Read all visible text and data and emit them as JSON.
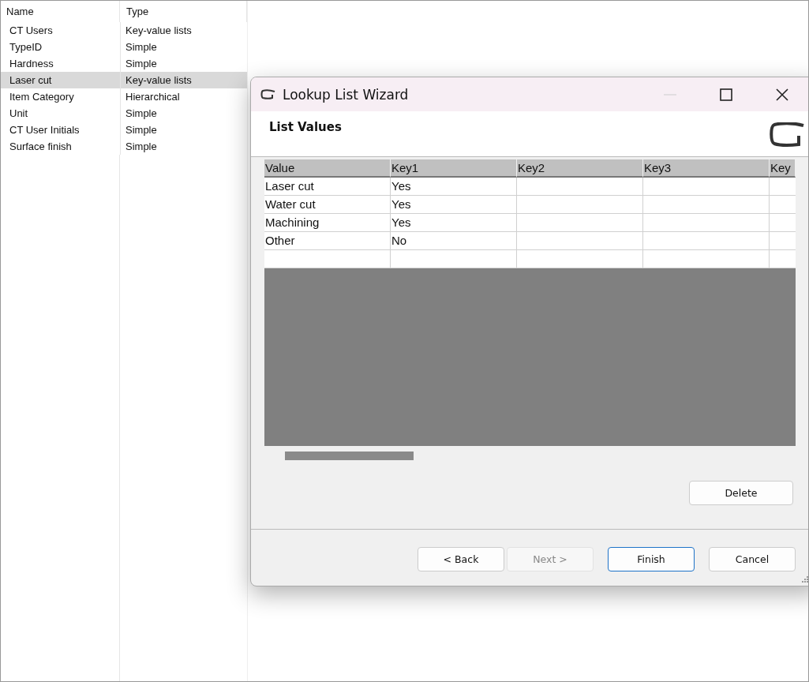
{
  "list": {
    "columns": [
      "Name",
      "Type"
    ],
    "rows": [
      {
        "name": "CT Users",
        "type": "Key-value lists",
        "selected": false
      },
      {
        "name": "TypeID",
        "type": "Simple",
        "selected": false
      },
      {
        "name": "Hardness",
        "type": "Simple",
        "selected": false
      },
      {
        "name": "Laser cut",
        "type": "Key-value lists",
        "selected": true
      },
      {
        "name": "Item Category",
        "type": "Hierarchical",
        "selected": false
      },
      {
        "name": "Unit",
        "type": "Simple",
        "selected": false
      },
      {
        "name": "CT User Initials",
        "type": "Simple",
        "selected": false
      },
      {
        "name": "Surface finish",
        "type": "Simple",
        "selected": false
      }
    ]
  },
  "dialog": {
    "title": "Lookup List Wizard",
    "heading": "List Values",
    "grid": {
      "columns": [
        "Value",
        "Key1",
        "Key2",
        "Key3",
        "Key"
      ],
      "rows": [
        [
          "Laser cut",
          "Yes",
          "",
          "",
          ""
        ],
        [
          "Water cut",
          "Yes",
          "",
          "",
          ""
        ],
        [
          "Machining",
          "Yes",
          "",
          "",
          ""
        ],
        [
          "Other",
          "No",
          "",
          "",
          ""
        ],
        [
          "",
          "",
          "",
          "",
          ""
        ]
      ]
    },
    "delete_button": "Delete",
    "buttons": [
      {
        "label": "< Back",
        "disabled": false,
        "default": false
      },
      {
        "label": "Next >",
        "disabled": true,
        "default": false
      },
      {
        "label": "Finish",
        "disabled": false,
        "default": true
      },
      {
        "label": "Cancel",
        "disabled": false,
        "default": false
      }
    ]
  }
}
